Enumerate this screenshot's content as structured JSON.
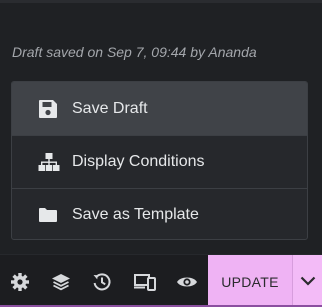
{
  "draft_status": "Draft saved on Sep 7, 09:44 by Ananda",
  "menu": {
    "items": [
      {
        "label": "Save Draft",
        "icon": "floppy-disk-icon",
        "active": true
      },
      {
        "label": "Display Conditions",
        "icon": "sitemap-icon",
        "active": false
      },
      {
        "label": "Save as Template",
        "icon": "folder-icon",
        "active": false
      }
    ]
  },
  "toolbar": {
    "icons": [
      "gear-icon",
      "layers-icon",
      "history-icon",
      "responsive-icon",
      "eye-icon",
      "chevron-down-icon"
    ],
    "update_label": "UPDATE"
  },
  "colors": {
    "background": "#1f2124",
    "menu_background": "#26282c",
    "active_item": "#404348",
    "update_button": "#efb3f4",
    "accent_line": "#8b4fa0"
  }
}
